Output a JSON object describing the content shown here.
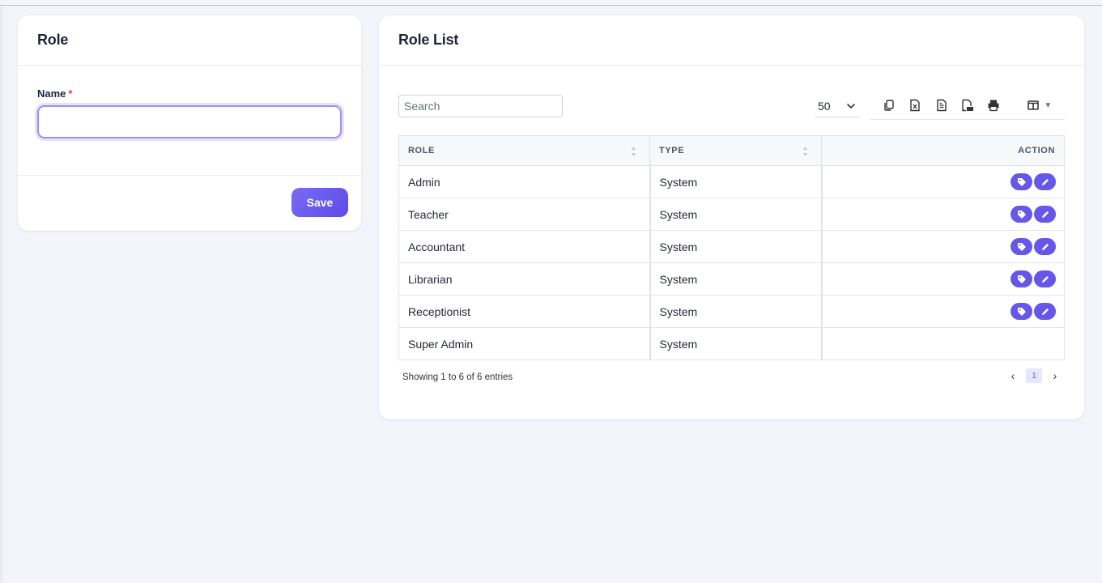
{
  "role_form": {
    "title": "Role",
    "name_label": "Name",
    "required_mark": "*",
    "name_value": "",
    "save_label": "Save"
  },
  "role_list": {
    "title": "Role List",
    "search_placeholder": "Search",
    "page_size": "50",
    "toolbar_icons": [
      "copy-icon",
      "excel-icon",
      "csv-icon",
      "pdf-icon",
      "print-icon",
      "column-visibility-icon"
    ],
    "columns": [
      "ROLE",
      "TYPE",
      "ACTION"
    ],
    "rows": [
      {
        "role": "Admin",
        "type": "System",
        "actions": true
      },
      {
        "role": "Teacher",
        "type": "System",
        "actions": true
      },
      {
        "role": "Accountant",
        "type": "System",
        "actions": true
      },
      {
        "role": "Librarian",
        "type": "System",
        "actions": true
      },
      {
        "role": "Receptionist",
        "type": "System",
        "actions": true
      },
      {
        "role": "Super Admin",
        "type": "System",
        "actions": false
      }
    ],
    "info": "Showing 1 to 6 of 6 entries",
    "current_page": "1",
    "prev_label": "‹",
    "next_label": "›"
  },
  "colors": {
    "accent": "#6657ea",
    "input_focus": "#9c90f0"
  }
}
